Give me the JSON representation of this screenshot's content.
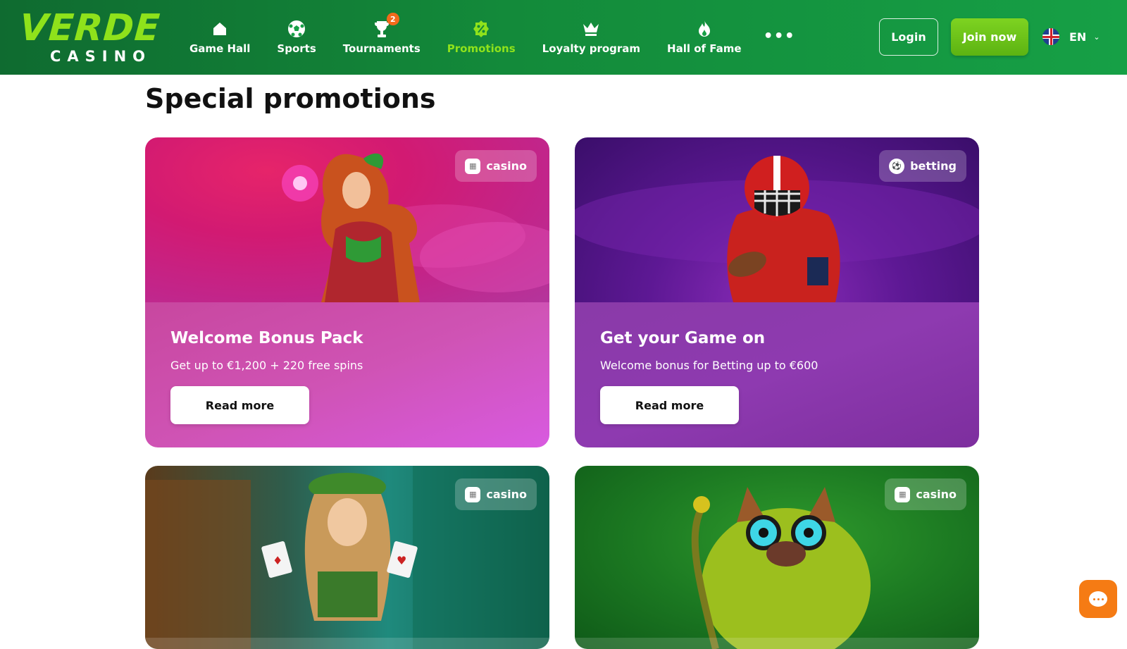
{
  "brand": {
    "name_top": "VERDE",
    "name_bottom": "CASINO"
  },
  "nav": {
    "items": [
      {
        "label": "Game Hall",
        "icon": "home-icon",
        "active": false
      },
      {
        "label": "Sports",
        "icon": "soccer-ball-icon",
        "active": false
      },
      {
        "label": "Tournaments",
        "icon": "trophy-icon",
        "active": false,
        "badge": "2"
      },
      {
        "label": "Promotions",
        "icon": "discount-icon",
        "active": true
      },
      {
        "label": "Loyalty program",
        "icon": "crown-icon",
        "active": false
      },
      {
        "label": "Hall of Fame",
        "icon": "flame-icon",
        "active": false
      }
    ],
    "more": "•••"
  },
  "header": {
    "login_label": "Login",
    "join_label": "Join now",
    "language": "EN"
  },
  "page": {
    "title": "Special promotions"
  },
  "promotions": [
    {
      "tag": "casino",
      "title": "Welcome Bonus Pack",
      "subtitle": "Get up to €1,200 + 220 free spins",
      "cta": "Read more"
    },
    {
      "tag": "betting",
      "title": "Get your Game on",
      "subtitle": "Welcome bonus for Betting up to €600",
      "cta": "Read more"
    },
    {
      "tag": "casino"
    },
    {
      "tag": "casino"
    }
  ],
  "colors": {
    "brand_green": "#16a046",
    "accent_lime": "#8fe21b",
    "chat_orange": "#f57b14"
  }
}
